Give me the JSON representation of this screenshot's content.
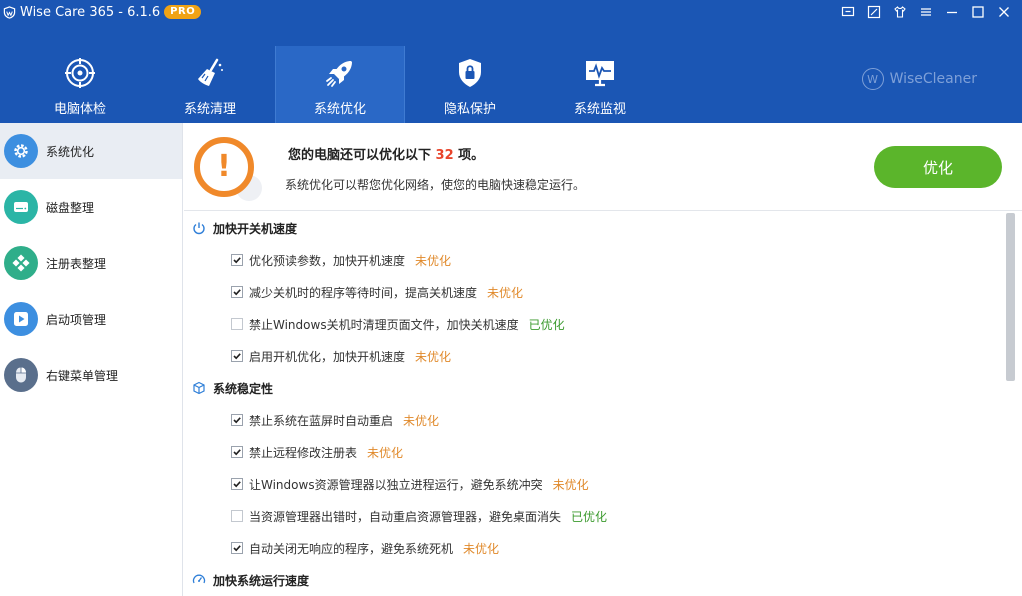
{
  "app": {
    "name": "Wise Care 365 - 6.1.6",
    "badge": "PRO",
    "brand": "WiseCleaner",
    "brand_mark": "W"
  },
  "colors": {
    "topbar": "#1b56b4",
    "accent_orange": "#f0892a",
    "status_unoptimized": "#e0892a",
    "status_optimized": "#3b9a2e",
    "button_green": "#5bb52b",
    "count_red": "#e8442b"
  },
  "window_controls": [
    {
      "icon": "screen-icon"
    },
    {
      "icon": "feedback-icon"
    },
    {
      "icon": "skin-icon"
    },
    {
      "icon": "menu-icon"
    },
    {
      "icon": "minimize-icon"
    },
    {
      "icon": "maximize-icon"
    },
    {
      "icon": "close-icon"
    }
  ],
  "tabs": [
    {
      "label": "电脑体检",
      "icon": "checkup-icon",
      "active": false
    },
    {
      "label": "系统清理",
      "icon": "broom-icon",
      "active": false
    },
    {
      "label": "系统优化",
      "icon": "rocket-icon",
      "active": true
    },
    {
      "label": "隐私保护",
      "icon": "shield-lock-icon",
      "active": false
    },
    {
      "label": "系统监视",
      "icon": "monitor-icon",
      "active": false
    }
  ],
  "sidebar": {
    "items": [
      {
        "label": "系统优化",
        "icon": "gear-icon",
        "active": true
      },
      {
        "label": "磁盘整理",
        "icon": "disk-icon",
        "active": false
      },
      {
        "label": "注册表整理",
        "icon": "registry-icon",
        "active": false
      },
      {
        "label": "启动项管理",
        "icon": "startup-icon",
        "active": false
      },
      {
        "label": "右键菜单管理",
        "icon": "mouse-icon",
        "active": false
      }
    ]
  },
  "banner": {
    "title_prefix": "您的电脑还可以优化以下",
    "count": "32",
    "title_suffix": "项。",
    "subtitle": "系统优化可以帮您优化网络，使您的电脑快速稳定运行。",
    "warning_symbol": "!",
    "button_label": "优化"
  },
  "sections": [
    {
      "title": "加快开关机速度",
      "icon": "power-icon",
      "items": [
        {
          "text": "优化预读参数，加快开机速度",
          "checked": true,
          "status": "未优化",
          "optimized": false
        },
        {
          "text": "减少关机时的程序等待时间，提高关机速度",
          "checked": true,
          "status": "未优化",
          "optimized": false
        },
        {
          "text": "禁止Windows关机时清理页面文件，加快关机速度",
          "checked": false,
          "status": "已优化",
          "optimized": true
        },
        {
          "text": "启用开机优化，加快开机速度",
          "checked": true,
          "status": "未优化",
          "optimized": false
        }
      ]
    },
    {
      "title": "系统稳定性",
      "icon": "cube-icon",
      "items": [
        {
          "text": "禁止系统在蓝屏时自动重启",
          "checked": true,
          "status": "未优化",
          "optimized": false
        },
        {
          "text": "禁止远程修改注册表",
          "checked": true,
          "status": "未优化",
          "optimized": false
        },
        {
          "text": "让Windows资源管理器以独立进程运行，避免系统冲突",
          "checked": true,
          "status": "未优化",
          "optimized": false
        },
        {
          "text": "当资源管理器出错时，自动重启资源管理器，避免桌面消失",
          "checked": false,
          "status": "已优化",
          "optimized": true
        },
        {
          "text": "自动关闭无响应的程序，避免系统死机",
          "checked": true,
          "status": "未优化",
          "optimized": false
        }
      ]
    },
    {
      "title": "加快系统运行速度",
      "icon": "speedometer-icon",
      "items": []
    }
  ]
}
